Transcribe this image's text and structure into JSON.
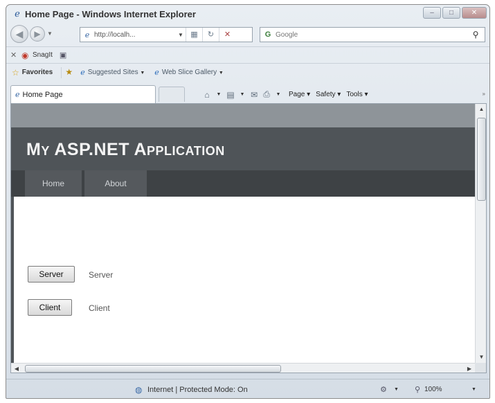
{
  "window": {
    "title": "Home Page - Windows Internet Explorer",
    "controls": {
      "minimize": "–",
      "maximize": "□",
      "close": "✕"
    }
  },
  "nav": {
    "back_glyph": "◀",
    "forward_glyph": "▶",
    "address": "http://localh...",
    "search_placeholder": "Google",
    "search_logo": "G"
  },
  "snagit": {
    "label": "SnagIt"
  },
  "favorites": {
    "label": "Favorites",
    "items": [
      "Suggested Sites",
      "Web Slice Gallery"
    ]
  },
  "tab": {
    "label": "Home Page"
  },
  "commands": {
    "page": "Page",
    "safety": "Safety",
    "tools": "Tools"
  },
  "site": {
    "title": "My ASP.NET Application",
    "menu": [
      "Home",
      "About"
    ]
  },
  "form": {
    "server_button": "Server",
    "server_label": "Server",
    "client_button": "Client",
    "client_label": "Client"
  },
  "status": {
    "zone": "Internet | Protected Mode: On",
    "zoom": "100%"
  },
  "colors": {
    "header": "#4f5458",
    "menu": "#3e4245",
    "band": "#8e9499"
  }
}
